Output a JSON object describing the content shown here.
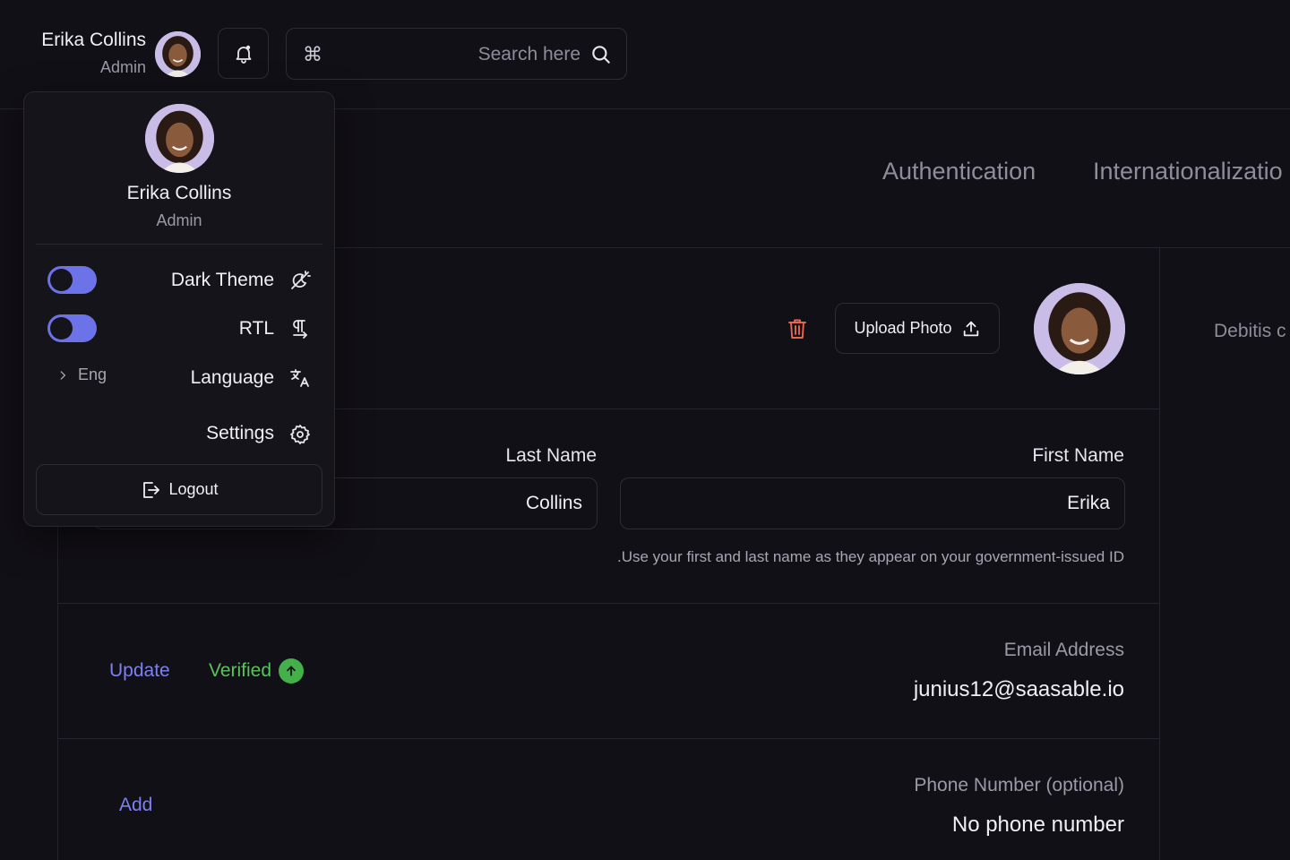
{
  "header": {
    "user_name": "Erika Collins",
    "user_role": "Admin",
    "search_placeholder": "Search here",
    "search_shortcut": "⌘"
  },
  "tabs": [
    {
      "label": "Authentication"
    },
    {
      "label": "Internationalizatio"
    }
  ],
  "dropdown": {
    "user_name": "Erika Collins",
    "user_role": "Admin",
    "dark_theme_label": "Dark Theme",
    "rtl_label": "RTL",
    "language_label": "Language",
    "language_value": "Eng",
    "settings_label": "Settings",
    "logout_label": "Logout"
  },
  "profile": {
    "upload_photo_label": "Upload Photo",
    "last_name_label": "Last Name",
    "first_name_label": "First Name",
    "last_name_value": "Collins",
    "first_name_value": "Erika",
    "helper_text": ".Use your first and last name as they appear on your government-issued ID",
    "email_label": "Email Address",
    "email_value": "junius12@saasable.io",
    "email_update_label": "Update",
    "email_status": "Verified",
    "phone_label": "Phone Number (optional)",
    "phone_value": "No phone number",
    "phone_add_label": "Add"
  },
  "side_text": "Debitis c",
  "colors": {
    "background": "#121017",
    "accent": "#7c80f0",
    "toggle": "#6c72e8",
    "verified": "#58c35b",
    "danger": "#e8664c"
  }
}
